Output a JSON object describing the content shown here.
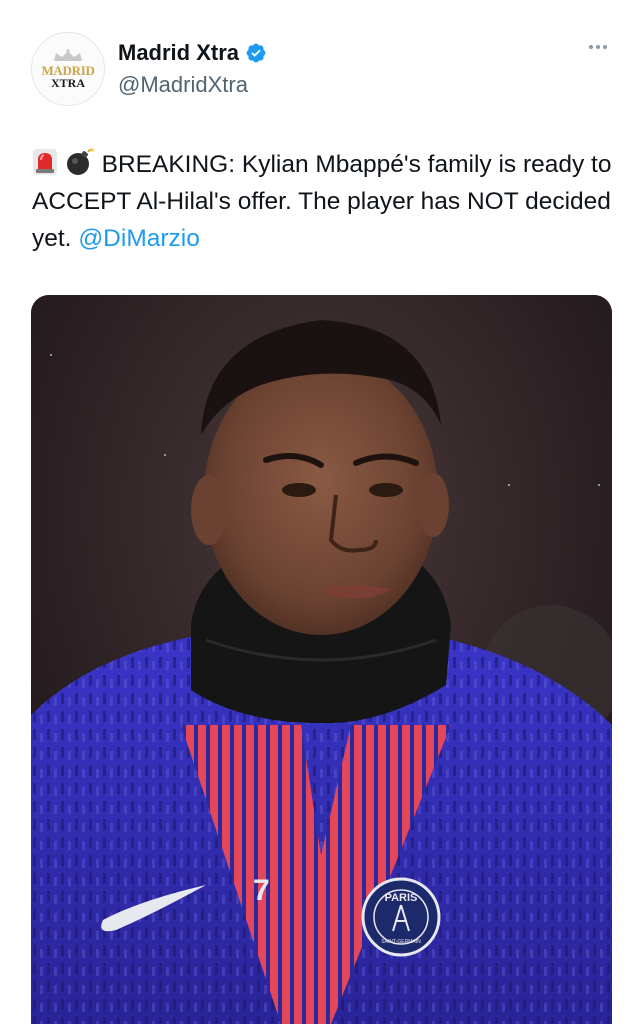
{
  "author": {
    "display_name": "Madrid Xtra",
    "handle": "@MadridXtra",
    "verified": true,
    "avatar_logo_top": "MADRID",
    "avatar_logo_bottom": "XTRA"
  },
  "tweet": {
    "emojis": [
      "rotating-light-icon",
      "bomb-icon"
    ],
    "text": "BREAKING: Kylian Mbappé's family is ready to ACCEPT Al-Hilal's offer. The player has NOT decided yet.",
    "mention": "@DiMarzio"
  },
  "media": {
    "jersey_number": "7",
    "crest_text": "PARIS",
    "crest_subtext": "SAINT-GERMAIN"
  },
  "colors": {
    "link": "#1d9bf0",
    "verified": "#1d9bf0",
    "text_primary": "#0f1419",
    "text_secondary": "#536471",
    "jersey_blue": "#3a2fb5",
    "jersey_red": "#e5475a"
  }
}
